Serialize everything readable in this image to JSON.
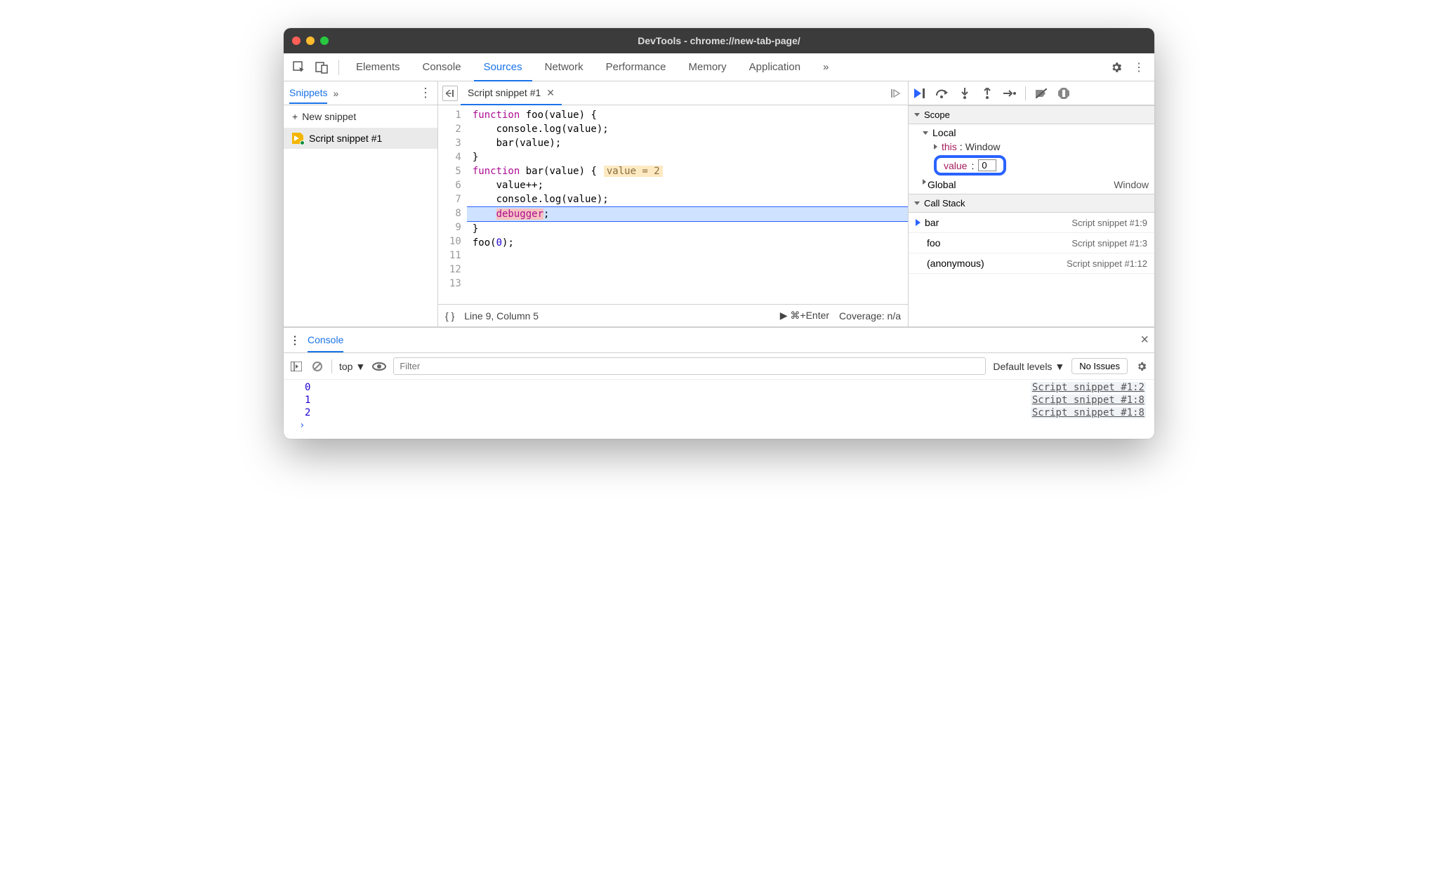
{
  "window": {
    "title": "DevTools - chrome://new-tab-page/"
  },
  "tabs": {
    "items": [
      "Elements",
      "Console",
      "Sources",
      "Network",
      "Performance",
      "Memory",
      "Application"
    ],
    "active": "Sources"
  },
  "sidebar": {
    "tab": "Snippets",
    "new_label": "New snippet",
    "items": [
      "Script snippet #1"
    ]
  },
  "editor": {
    "tab_label": "Script snippet #1",
    "lines": [
      {
        "n": 1,
        "html": "<span class='kw'>function</span> foo(value) {"
      },
      {
        "n": 2,
        "html": "    console.log(value);"
      },
      {
        "n": 3,
        "html": "    bar(value);"
      },
      {
        "n": 4,
        "html": "}"
      },
      {
        "n": 5,
        "html": ""
      },
      {
        "n": 6,
        "html": "<span class='kw'>function</span> bar(value) {",
        "inline": "value = 2"
      },
      {
        "n": 7,
        "html": "    value++;"
      },
      {
        "n": 8,
        "html": "    console.log(value);"
      },
      {
        "n": 9,
        "html": "    <span class='dbg'>debugger</span>;",
        "exec": true
      },
      {
        "n": 10,
        "html": "}"
      },
      {
        "n": 11,
        "html": ""
      },
      {
        "n": 12,
        "html": "foo(<span class='num'>0</span>);"
      },
      {
        "n": 13,
        "html": ""
      }
    ],
    "status": {
      "cursor": "Line 9, Column 5",
      "run": "⌘+Enter",
      "coverage": "Coverage: n/a"
    }
  },
  "debug": {
    "scope_label": "Scope",
    "local_label": "Local",
    "this_label": "this",
    "this_val": "Window",
    "value_label": "value",
    "value_val": "0",
    "global_label": "Global",
    "global_val": "Window",
    "callstack_label": "Call Stack",
    "stack": [
      {
        "fn": "bar",
        "loc": "Script snippet #1:9",
        "active": true
      },
      {
        "fn": "foo",
        "loc": "Script snippet #1:3"
      },
      {
        "fn": "(anonymous)",
        "loc": "Script snippet #1:12"
      }
    ]
  },
  "console": {
    "tab": "Console",
    "context": "top",
    "filter_placeholder": "Filter",
    "levels": "Default levels",
    "issues": "No Issues",
    "rows": [
      {
        "val": "0",
        "src": "Script snippet #1:2"
      },
      {
        "val": "1",
        "src": "Script snippet #1:8"
      },
      {
        "val": "2",
        "src": "Script snippet #1:8"
      }
    ]
  }
}
